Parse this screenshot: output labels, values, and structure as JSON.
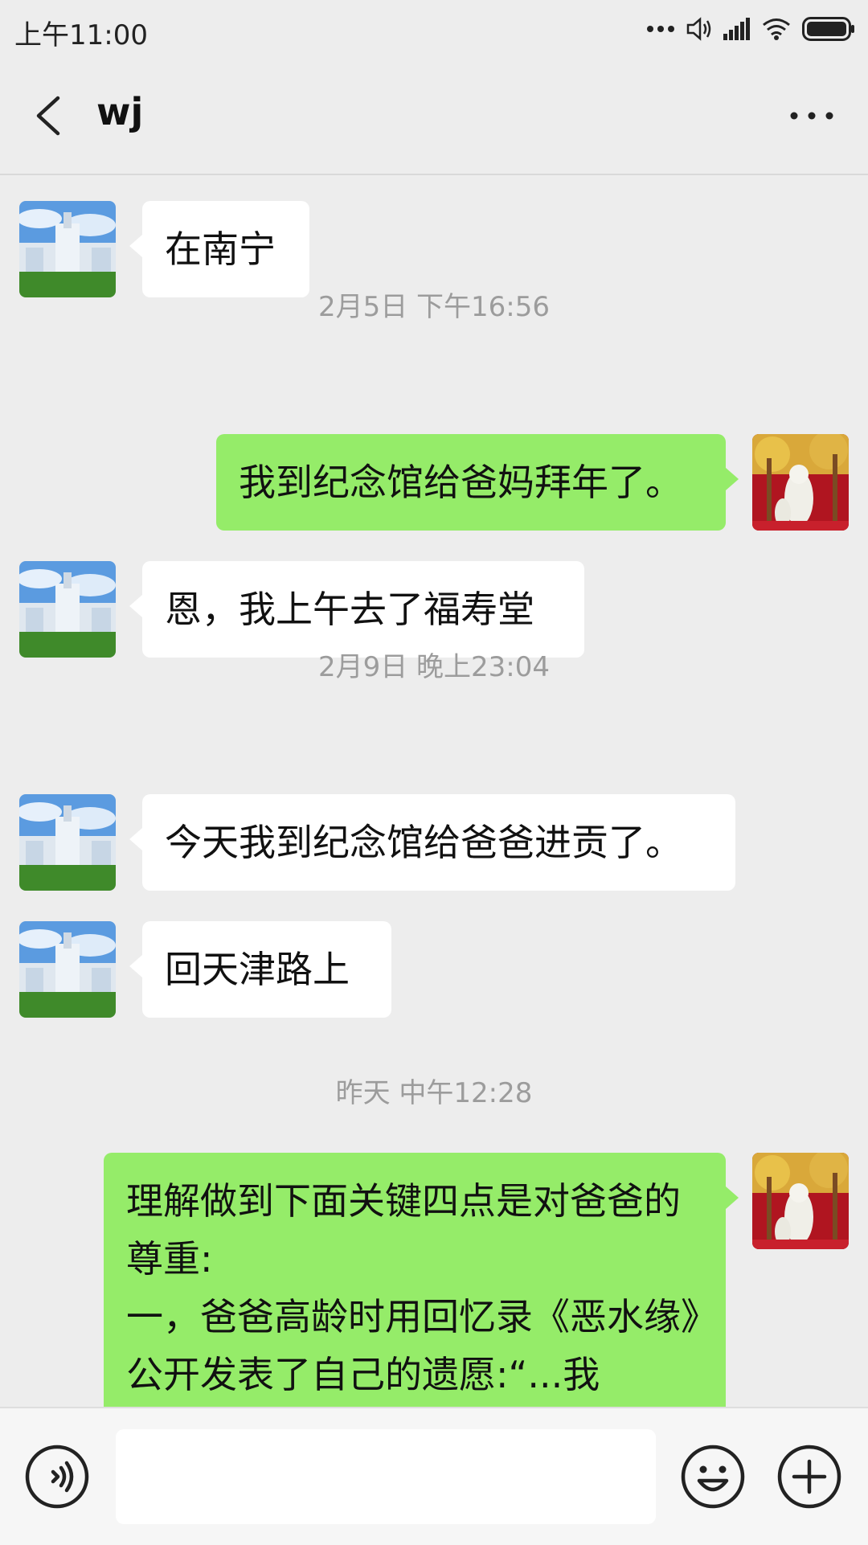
{
  "status_bar": {
    "time": "上午11:00",
    "icons": [
      "more-dots-icon",
      "volume-icon",
      "signal-icon",
      "wifi-icon",
      "battery-icon"
    ]
  },
  "header": {
    "title": "wj",
    "back_icon": "chevron-left-icon",
    "more_icon": "more-horizontal-icon"
  },
  "messages": [
    {
      "type": "message",
      "direction": "in",
      "text": "在南宁"
    },
    {
      "type": "timestamp",
      "text": "2月5日 下午16:56"
    },
    {
      "type": "message",
      "direction": "out",
      "text": "我到纪念馆给爸妈拜年了。"
    },
    {
      "type": "message",
      "direction": "in",
      "text": "恩，我上午去了福寿堂"
    },
    {
      "type": "timestamp",
      "text": "2月9日 晚上23:04"
    },
    {
      "type": "message",
      "direction": "in",
      "text": "今天我到纪念馆给爸爸进贡了。"
    },
    {
      "type": "message",
      "direction": "in",
      "text": "回天津路上"
    },
    {
      "type": "timestamp",
      "text": "昨天 中午12:28"
    },
    {
      "type": "message",
      "direction": "out",
      "text": "理解做到下面关键四点是对爸爸的尊重:\n一，爸爸高龄时用回忆录《恶水缘》公开发表了自己的遗愿:“...我"
    }
  ],
  "input_bar": {
    "voice_icon": "voice-icon",
    "input_value": "",
    "emoji_icon": "emoji-icon",
    "plus_icon": "plus-icon"
  },
  "colors": {
    "background": "#ededed",
    "bubble_out": "#95ec69",
    "bubble_in": "#ffffff",
    "timestamp": "#9c9c9c"
  }
}
